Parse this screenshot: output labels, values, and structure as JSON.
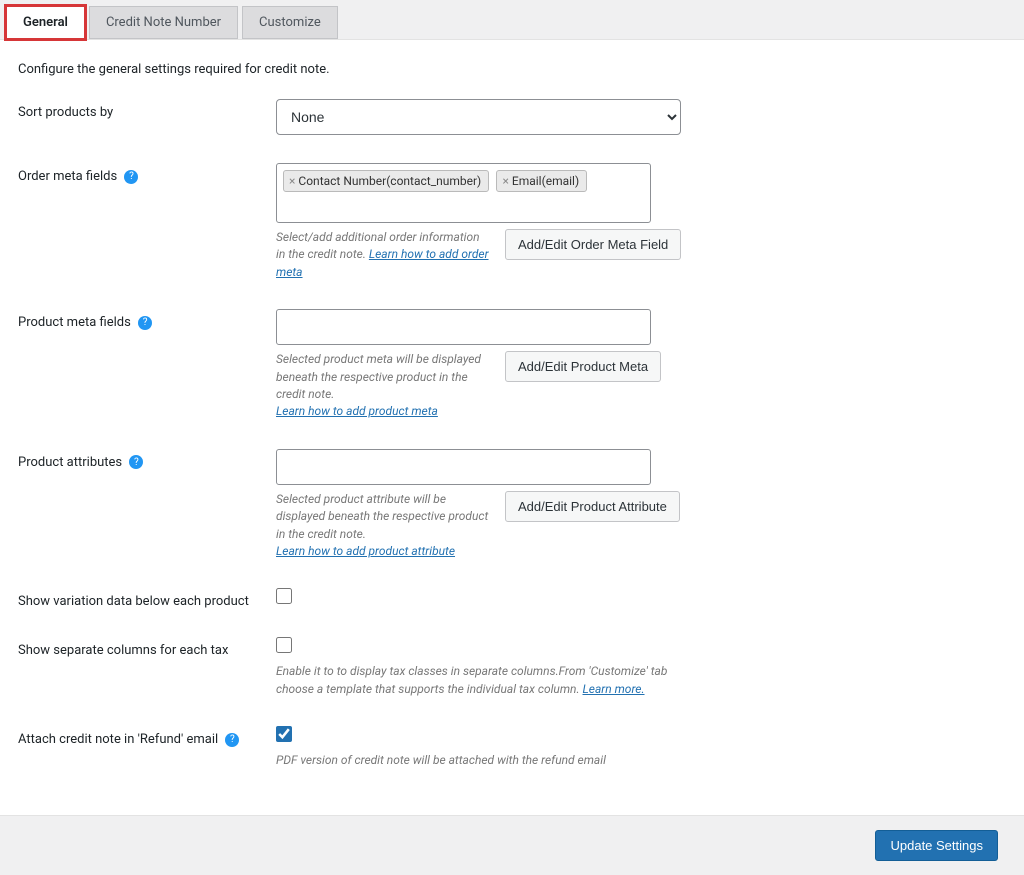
{
  "tabs": {
    "general": "General",
    "number": "Credit Note Number",
    "customize": "Customize"
  },
  "intro": "Configure the general settings required for credit note.",
  "sort": {
    "label": "Sort products by",
    "value": "None"
  },
  "orderMeta": {
    "label": "Order meta fields",
    "tags": [
      "Contact Number(contact_number)",
      "Email(email)"
    ],
    "desc": "Select/add additional order information in the credit note.",
    "link": "Learn how to add order meta",
    "btn": "Add/Edit Order Meta Field"
  },
  "productMeta": {
    "label": "Product meta fields",
    "desc": "Selected product meta will be displayed beneath the respective product in the credit note.",
    "link": "Learn how to add product meta",
    "btn": "Add/Edit Product Meta"
  },
  "productAttr": {
    "label": "Product attributes",
    "desc": "Selected product attribute will be displayed beneath the respective product in the credit note.",
    "link": "Learn how to add product attribute",
    "btn": "Add/Edit Product Attribute"
  },
  "variation": {
    "label": "Show variation data below each product"
  },
  "taxCols": {
    "label": "Show separate columns for each tax",
    "desc": "Enable it to to display tax classes in separate columns.From 'Customize' tab choose a template that supports the individual tax column.",
    "link": "Learn more."
  },
  "attach": {
    "label": "Attach credit note in 'Refund' email",
    "desc": "PDF version of credit note will be attached with the refund email"
  },
  "footer": {
    "save": "Update Settings"
  }
}
